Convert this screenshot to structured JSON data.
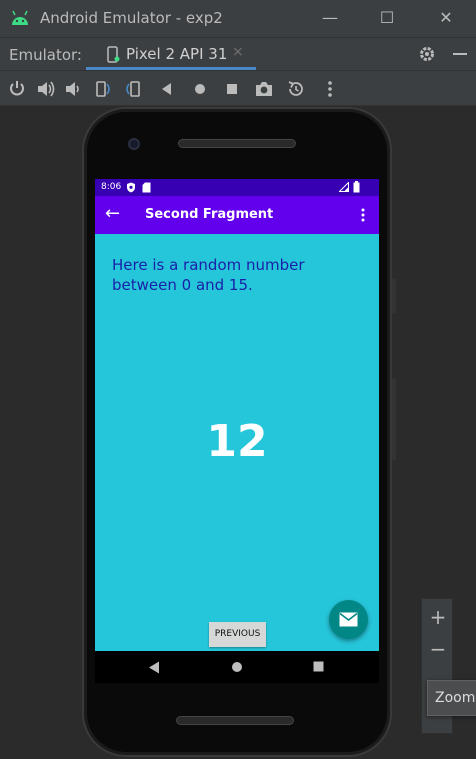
{
  "window": {
    "title": "Android Emulator - exp2",
    "buttons": {
      "minimize": "—",
      "maximize": "☐",
      "close": "✕"
    }
  },
  "tabbar": {
    "label": "Emulator:",
    "active_tab": "Pixel 2 API 31",
    "close_glyph": "×"
  },
  "toolbar": {
    "icons": [
      "power-icon",
      "volume-up-icon",
      "volume-down-icon",
      "rotate-left-icon",
      "rotate-right-icon",
      "back-icon",
      "home-icon",
      "overview-icon",
      "camera-icon",
      "snapshot-icon",
      "more-icon"
    ]
  },
  "device": {
    "status_time": "8:06",
    "appbar_title": "Second Fragment",
    "message": "Here is a random number between 0 and 15.",
    "random_number": "12",
    "previous_button": "PREVIOUS"
  },
  "zoom": {
    "zoom_in": "+",
    "zoom_out": "−",
    "tooltip": "Zoom"
  },
  "colors": {
    "status_bar": "#3700b3",
    "app_bar": "#6200ee",
    "screen_background": "#26c6da",
    "fab": "#018786",
    "message_text": "#1a21a8",
    "tab_underline": "#4a88c7"
  }
}
